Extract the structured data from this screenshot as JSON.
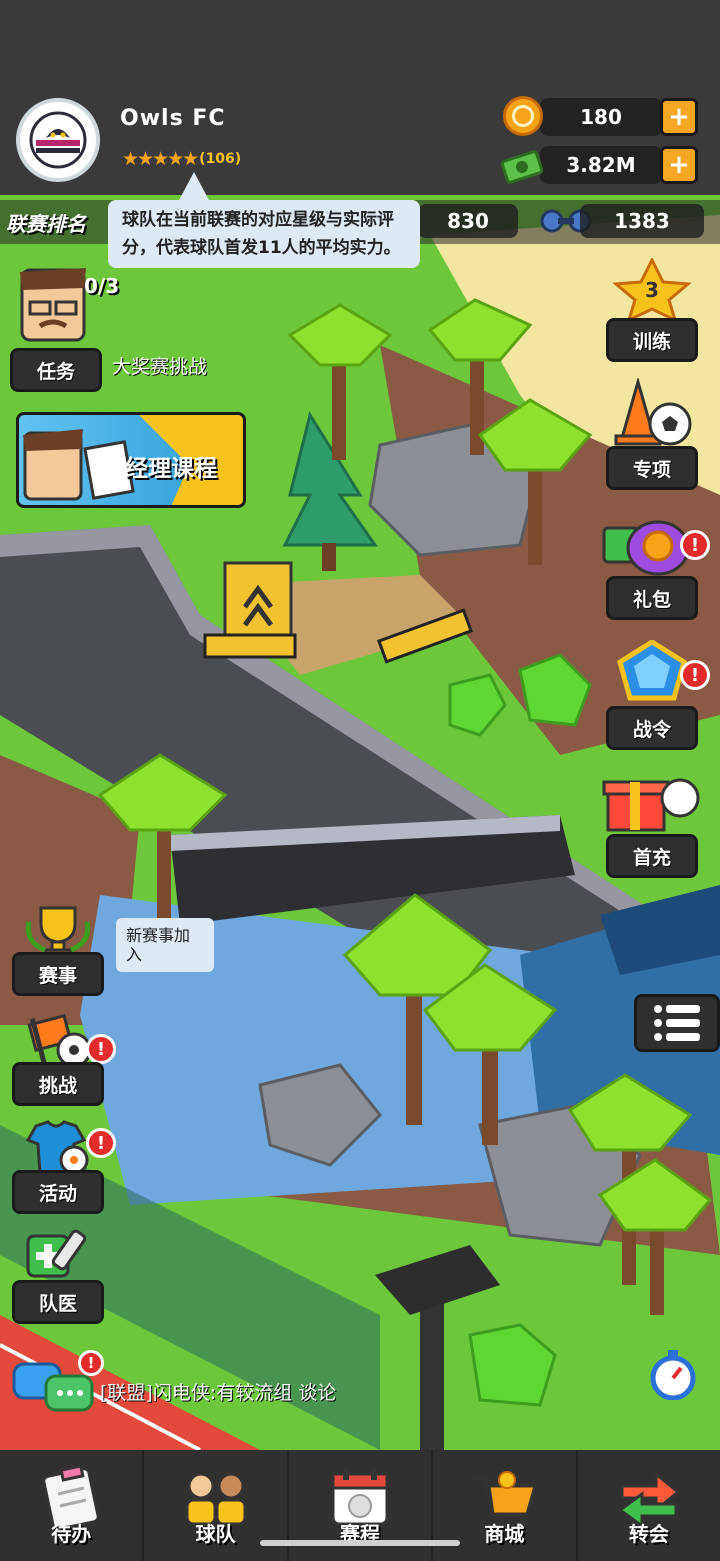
{
  "team": {
    "name": "Owls FC",
    "stars": "★★★★★",
    "rating": "(106)"
  },
  "resources": {
    "coins": "180",
    "cash": "3.82M",
    "plus": "+"
  },
  "league": {
    "label": "联赛排名",
    "partial": "0/3",
    "stat_a": "830",
    "stat_b": "1383"
  },
  "tooltip": "球队在当前联赛的对应星级与实际评分，代表球队首发11人的平均实力。",
  "left_menu": {
    "tasks": "任务",
    "tasks_caption": "大奖赛挑战",
    "course": "经理课程",
    "events": "赛事",
    "events_bubble": "新赛事加入",
    "challenge": "挑战",
    "activity": "活动",
    "doctor": "队医"
  },
  "right_menu": {
    "training": "训练",
    "training_count": "3",
    "special": "专项",
    "gift": "礼包",
    "pass": "战令",
    "first_recharge": "首充"
  },
  "alert_mark": "!",
  "chat": {
    "text": "[联盟]闪电侠:有较流组 谈论"
  },
  "bottom_nav": [
    {
      "label": "待办"
    },
    {
      "label": "球队"
    },
    {
      "label": "赛程"
    },
    {
      "label": "商城"
    },
    {
      "label": "转会"
    }
  ],
  "colors": {
    "grass": "#6cc83a",
    "road": "#4a4d52",
    "dirt": "#8a5a45",
    "accent": "#f5a623",
    "alert": "#e32b2b"
  }
}
